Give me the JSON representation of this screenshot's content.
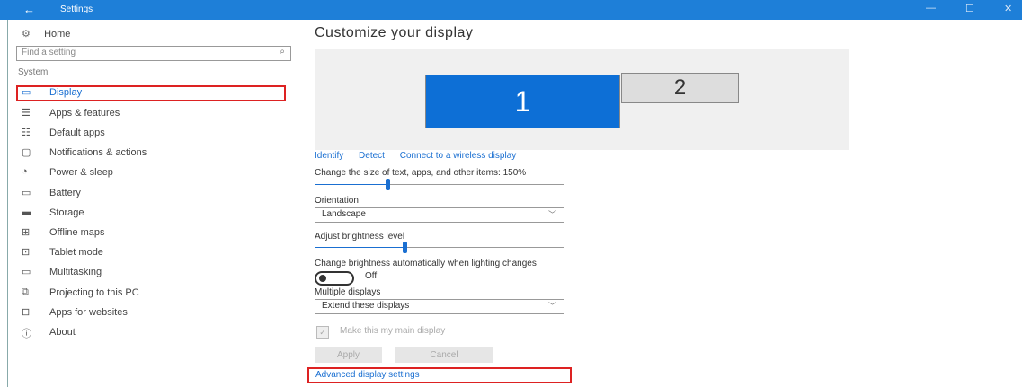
{
  "window": {
    "title": "Settings",
    "back_icon": "←",
    "minimize_icon": "—",
    "maximize_icon": "☐",
    "close_icon": "✕"
  },
  "sidebar": {
    "home_label": "Home",
    "search_placeholder": "Find a setting",
    "section_label": "System",
    "items": [
      {
        "label": "Display",
        "icon": "▭"
      },
      {
        "label": "Apps & features",
        "icon": "☰"
      },
      {
        "label": "Default apps",
        "icon": "☷"
      },
      {
        "label": "Notifications & actions",
        "icon": "▢"
      },
      {
        "label": "Power & sleep",
        "icon": "◔"
      },
      {
        "label": "Battery",
        "icon": "▭"
      },
      {
        "label": "Storage",
        "icon": "▬"
      },
      {
        "label": "Offline maps",
        "icon": "⊞"
      },
      {
        "label": "Tablet mode",
        "icon": "⊡"
      },
      {
        "label": "Multitasking",
        "icon": "▭"
      },
      {
        "label": "Projecting to this PC",
        "icon": "⧉"
      },
      {
        "label": "Apps for websites",
        "icon": "⊟"
      },
      {
        "label": "About",
        "icon": "ⓘ"
      }
    ]
  },
  "main": {
    "title": "Customize your display",
    "monitor1": "1",
    "monitor2": "2",
    "links": {
      "identify": "Identify",
      "detect": "Detect",
      "wireless": "Connect to a wireless display"
    },
    "scale_label": "Change the size of text, apps, and other items: 150%",
    "scale_level": 0.29,
    "orientation_label": "Orientation",
    "orientation_value": "Landscape",
    "brightness_label": "Adjust brightness level",
    "brightness_level": 0.36,
    "auto_brightness_label": "Change brightness automatically when lighting changes",
    "auto_brightness_state": "Off",
    "multiple_displays_label": "Multiple displays",
    "multiple_displays_value": "Extend these displays",
    "main_display_label": "Make this my main display",
    "apply_label": "Apply",
    "cancel_label": "Cancel",
    "advanced_link": "Advanced display settings"
  }
}
